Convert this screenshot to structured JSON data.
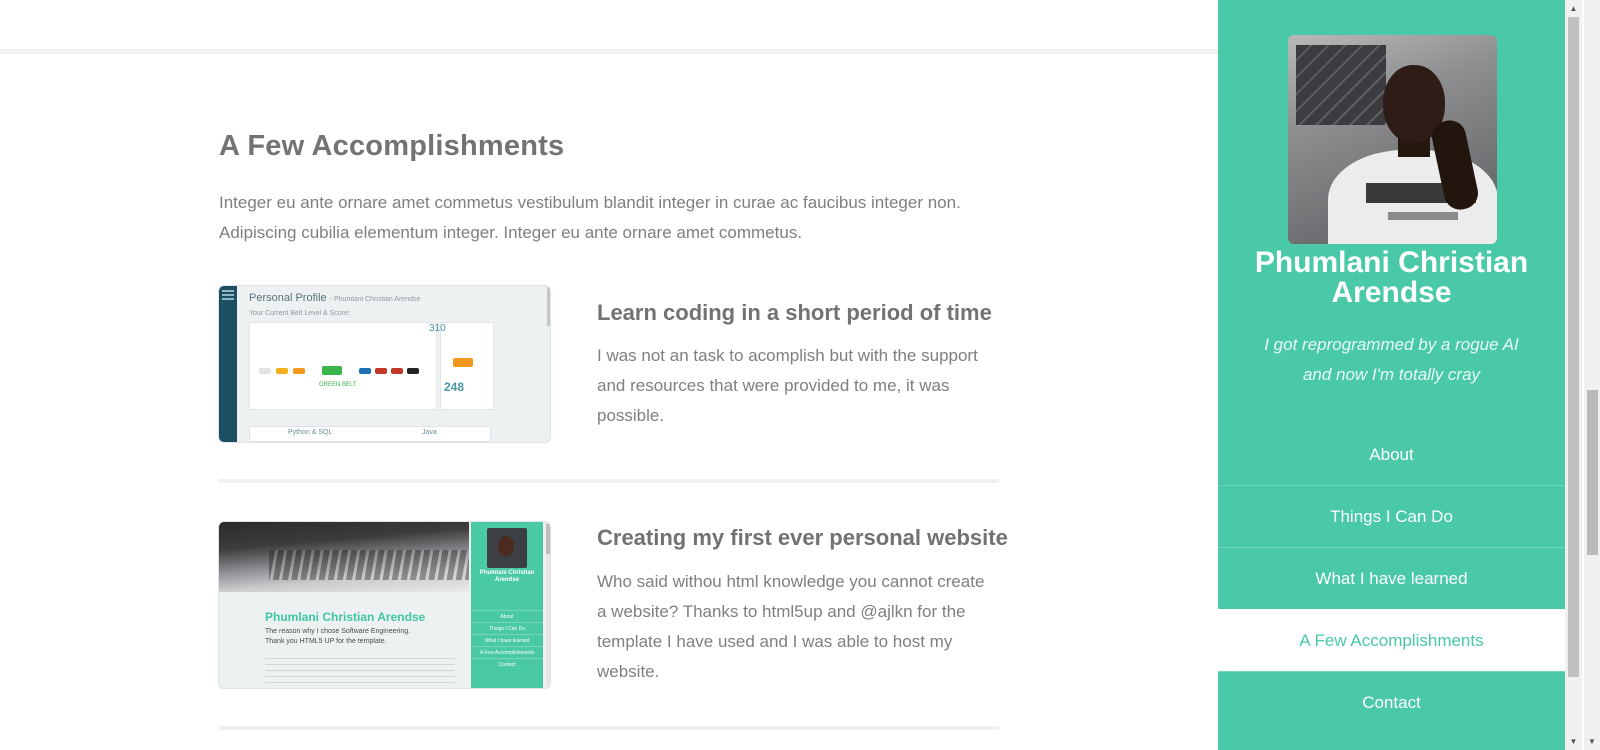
{
  "main": {
    "section_title": "A Few Accomplishments",
    "intro": "Integer eu ante ornare amet commetus vestibulum blandit integer in curae ac faucibus integer non. Adipiscing cubilia elementum integer. Integer eu ante ornare amet commetus.",
    "items": [
      {
        "title": "Learn coding in a short period of time",
        "text": "I was not an task to acomplish but with the support and resources that were provided to me, it was possible.",
        "thumb": {
          "heading": "Personal Profile",
          "heading_sub": "- Phumlani Christian Arendse",
          "sub": "Your Current Belt Level & Score:",
          "score": "310",
          "belt_label": "GREEN BELT",
          "average": "248",
          "tabs": [
            "Python & SQL",
            "Java"
          ]
        }
      },
      {
        "title": "Creating my first ever personal website",
        "text": "Who said withou html knowledge you cannot create a website? Thanks to html5up and @ajlkn for the template I have used and I was able to host my website.",
        "thumb": {
          "name": "Phumlani Christian Arendse",
          "sub1": "The reason why I chose Software Engineering.",
          "sub2": "Thank you HTML5 UP for the template.",
          "side_name": "Phumlani Christian Arendse",
          "nav": [
            "About",
            "Things I Can Do",
            "What I have learned",
            "A Few Accomplishments",
            "Contact"
          ]
        }
      }
    ]
  },
  "sidebar": {
    "name": "Phumlani Christian Arendse",
    "tagline_line1": "I got reprogrammed by a rogue AI",
    "tagline_line2": "and now I'm totally cray",
    "nav": [
      {
        "label": "About",
        "active": false
      },
      {
        "label": "Things I Can Do",
        "active": false
      },
      {
        "label": "What I have learned",
        "active": false
      },
      {
        "label": "A Few Accomplishments",
        "active": true
      },
      {
        "label": "Contact",
        "active": false
      }
    ],
    "accent_color": "#49c9a8"
  }
}
